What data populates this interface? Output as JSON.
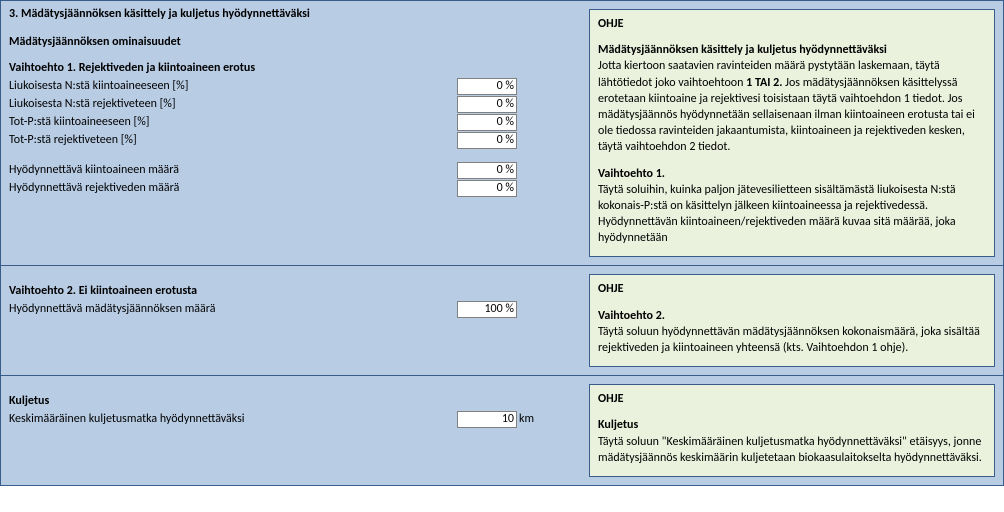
{
  "section3": {
    "title": "3. Mädätysjäännöksen käsittely ja kuljetus hyödynnettäväksi",
    "props_title": "Mädätysjäännöksen ominaisuudet",
    "option1": {
      "title": "Vaihtoehto 1. Rejektiveden ja kiintoaineen erotus",
      "rows": [
        {
          "label": "Liukoisesta N:stä kiintoaineeseen [%]",
          "value": "0 %"
        },
        {
          "label": "Liukoisesta N:stä rejektiveteen [%]",
          "value": "0 %"
        },
        {
          "label": "Tot-P:stä kiintoaineeseen [%]",
          "value": "0 %"
        },
        {
          "label": "Tot-P:stä rejektiveteen [%]",
          "value": "0 %"
        }
      ],
      "rows2": [
        {
          "label": "Hyödynnettävä kiintoaineen määrä",
          "value": "0 %"
        },
        {
          "label": "Hyödynnettävä rejektiveden määrä",
          "value": "0 %"
        }
      ]
    },
    "ohje1": {
      "title": "OHJE",
      "sub": "Mädätysjäännöksen  käsittely ja kuljetus hyödynnettäväksi",
      "p1a": "Jotta kiertoon saatavien ravinteiden määrä pystytään laskemaan, täytä lähtötiedot joko vaihtoehtoon ",
      "p1b": "1 TAI 2.",
      "p1c": " Jos mädätysjäännöksen käsittelyssä erotetaan kiintoaine ja rejektivesi toisistaan täytä vaihtoehdon 1 tiedot. Jos mädätysjäännös hyödynnetään sellaisenaan ilman kiintoaineen erotusta tai ei ole tiedossa ravinteiden jakaantumista, kiintoaineen ja rejektiveden kesken, täytä vaihtoehdon 2 tiedot.",
      "v1_title": "Vaihtoehto 1.",
      "v1_p1": "Täytä soluihin, kuinka paljon jätevesilietteen sisältämästä liukoisesta N:stä  kokonais-P:stä on käsittelyn jälkeen kiintoaineessa ja rejektivedessä.",
      "v1_p2": "Hyödynnettävän kiintoaineen/rejektiveden määrä kuvaa sitä määrää, joka hyödynnetään"
    }
  },
  "option2": {
    "title": "Vaihtoehto 2. Ei kiintoaineen erotusta",
    "row": {
      "label": "Hyödynnettävä mädätysjäännöksen määrä",
      "value": "100 %"
    },
    "ohje": {
      "title": "OHJE",
      "sub": "Vaihtoehto 2.",
      "p": "Täytä soluun hyödynnettävän mädätysjäännöksen kokonaismäärä, joka sisältää rejektiveden ja kiintoaineen yhteensä  (kts. Vaihtoehdon 1 ohje)."
    }
  },
  "kuljetus": {
    "title": "Kuljetus",
    "row": {
      "label": "Keskimääräinen kuljetusmatka hyödynnettäväksi",
      "value": "10",
      "unit": "km"
    },
    "ohje": {
      "title": "OHJE",
      "sub": "Kuljetus",
      "p": "Täytä soluun \"Keskimääräinen kuljetusmatka hyödynnettäväksi\" etäisyys, jonne mädätysjäännös keskimäärin kuljetetaan biokaasulaitokselta hyödynnettäväksi."
    }
  }
}
